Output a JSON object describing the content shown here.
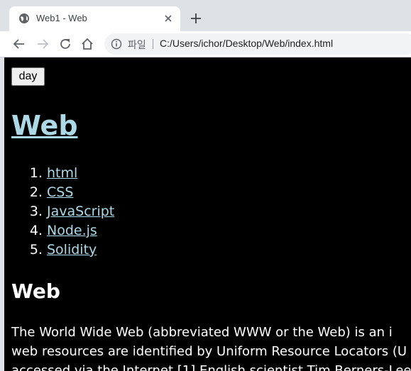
{
  "browser": {
    "tab": {
      "title": "Web1 - Web"
    },
    "omnibox": {
      "scheme_label": "파일",
      "url": "C:/Users/ichor/Desktop/Web/index.html"
    },
    "icons": {
      "favicon": "globe-icon",
      "tab_close": "close-icon",
      "new_tab": "plus-icon",
      "back": "back-arrow-icon",
      "forward": "forward-arrow-icon",
      "reload": "reload-icon",
      "home": "home-icon",
      "info": "info-icon"
    }
  },
  "page": {
    "theme_colors": {
      "background": "#000000",
      "text": "#ffffff",
      "link": "#add8e6"
    },
    "toggle_button": "day",
    "title": "Web",
    "nav_items": [
      {
        "number": 1,
        "label": "html"
      },
      {
        "number": 2,
        "label": "CSS"
      },
      {
        "number": 3,
        "label": "JavaScript"
      },
      {
        "number": 4,
        "label": "Node.js"
      },
      {
        "number": 5,
        "label": "Solidity"
      }
    ],
    "section_heading": "Web",
    "paragraph_lines": [
      "The World Wide Web (abbreviated WWW or the Web) is an i",
      "web resources are identified by Uniform Resource Locators (U",
      "accessed via the Internet.[1] English scientist Tim Berners-Lee"
    ]
  }
}
